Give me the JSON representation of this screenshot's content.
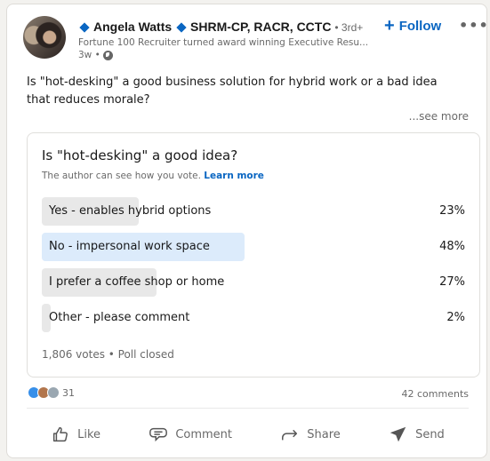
{
  "author": {
    "name": "Angela Watts",
    "credentials": "SHRM-CP, RACR, CCTC",
    "degree": "• 3rd+",
    "headline": "Fortune 100 Recruiter turned award winning Executive Resu...",
    "time": "3w •",
    "visibility_icon": "globe-icon"
  },
  "header": {
    "follow_label": "Follow",
    "follow_icon": "+",
    "more_icon": "•••"
  },
  "post": {
    "text": "Is \"hot-desking\" a good business solution for hybrid work or a bad idea that reduces morale?",
    "see_more": "...see more"
  },
  "poll": {
    "question": "Is \"hot-desking\" a good idea?",
    "note": "The author can see how you vote.",
    "learn_more": "Learn more",
    "options": [
      {
        "label": "Yes - enables hybrid options",
        "percent_text": "23%",
        "percent": 23,
        "winner": false
      },
      {
        "label": "No - impersonal work space",
        "percent_text": "48%",
        "percent": 48,
        "winner": true
      },
      {
        "label": "I prefer a coffee shop or home",
        "percent_text": "27%",
        "percent": 27,
        "winner": false
      },
      {
        "label": "Other - please comment",
        "percent_text": "2%",
        "percent": 2,
        "winner": false
      }
    ],
    "footer": "1,806 votes • Poll closed"
  },
  "social": {
    "reactions": [
      "like",
      "love",
      "insightful"
    ],
    "reaction_count": "31",
    "comments": "42 comments"
  },
  "actions": [
    {
      "label": "Like",
      "icon": "thumbs-up-icon"
    },
    {
      "label": "Comment",
      "icon": "comment-icon"
    },
    {
      "label": "Share",
      "icon": "share-arrow-icon"
    },
    {
      "label": "Send",
      "icon": "send-icon"
    }
  ],
  "colors": {
    "brand": "#0a66c2",
    "winner_bar": "#dcebfb",
    "bar": "#e8e8e8"
  }
}
